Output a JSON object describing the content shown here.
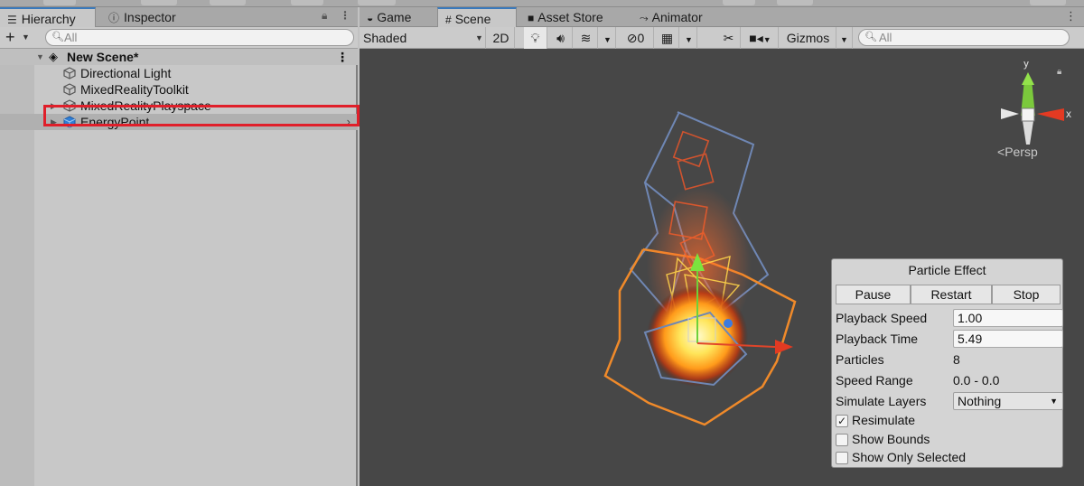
{
  "hierarchy_panel": {
    "tab_hierarchy": "Hierarchy",
    "tab_inspector": "Inspector",
    "search_placeholder": "All",
    "scene_name": "New Scene*",
    "items": [
      {
        "label": "Directional Light"
      },
      {
        "label": "MixedRealityToolkit"
      },
      {
        "label": "MixedRealityPlayspace"
      },
      {
        "label": "EnergyPoint"
      }
    ]
  },
  "scene_panel": {
    "tabs": [
      "Game",
      "Scene",
      "Asset Store",
      "Animator"
    ],
    "active_tab": "Scene",
    "shading_mode": "Shaded",
    "mode_2d": "2D",
    "hidden_count": "0",
    "gizmos_label": "Gizmos",
    "search_placeholder": "All",
    "projection_label": "Persp",
    "axis_y": "y",
    "axis_x": "x"
  },
  "particle_effect": {
    "title": "Particle Effect",
    "buttons": [
      "Pause",
      "Restart",
      "Stop"
    ],
    "playback_speed_label": "Playback Speed",
    "playback_speed": "1.00",
    "playback_time_label": "Playback Time",
    "playback_time": "5.49",
    "particles_label": "Particles",
    "particles": "8",
    "speed_range_label": "Speed Range",
    "speed_range": "0.0 - 0.0",
    "simulate_layers_label": "Simulate Layers",
    "simulate_layers": "Nothing",
    "resimulate_label": "Resimulate",
    "resimulate_checked": true,
    "show_bounds_label": "Show Bounds",
    "show_bounds_checked": false,
    "show_only_selected_label": "Show Only Selected",
    "show_only_selected_checked": false
  },
  "colors": {
    "selection_highlight": "#e01f2a",
    "scene_background": "#474747",
    "tab_accent": "#3a79bb"
  }
}
